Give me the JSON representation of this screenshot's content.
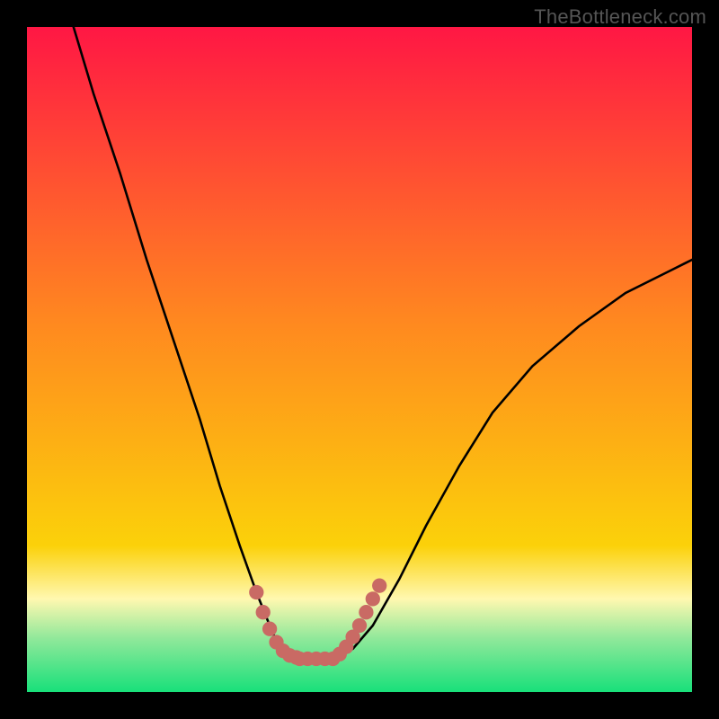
{
  "watermark": "TheBottleneck.com",
  "colors": {
    "frame": "#000000",
    "curve": "#000000",
    "dots": "#c96a64",
    "grad_top": "#ff1744",
    "grad_mid": "#fbd10a",
    "grad_low1": "#fff8b0",
    "grad_low2": "#8fe89a",
    "grad_bottom": "#18e07a"
  },
  "chart_data": {
    "type": "line",
    "title": "",
    "xlabel": "",
    "ylabel": "",
    "xlim": [
      0,
      100
    ],
    "ylim": [
      0,
      100
    ],
    "note": "x = normalized horizontal position (0 left → 100 right), y = normalized height (0 bottom → 100 top); values estimated from pixels",
    "series": [
      {
        "name": "curve",
        "x": [
          7,
          10,
          14,
          18,
          22,
          26,
          29,
          32,
          34.5,
          36.5,
          38,
          39.5,
          41,
          43,
          46,
          49,
          52,
          56,
          60,
          65,
          70,
          76,
          83,
          90,
          97,
          100
        ],
        "y": [
          100,
          90,
          78,
          65,
          53,
          41,
          31,
          22,
          15,
          10,
          6.5,
          5.2,
          5,
          5,
          5.2,
          6.5,
          10,
          17,
          25,
          34,
          42,
          49,
          55,
          60,
          63.5,
          65
        ]
      },
      {
        "name": "dots-left",
        "x": [
          34.5,
          35.5,
          36.5,
          37.5,
          38.5,
          39.5,
          40.5
        ],
        "y": [
          15,
          12,
          9.5,
          7.5,
          6.2,
          5.5,
          5.2
        ]
      },
      {
        "name": "dots-bottom",
        "x": [
          41,
          42.2,
          43.5,
          44.8,
          46
        ],
        "y": [
          5,
          5,
          5,
          5,
          5
        ]
      },
      {
        "name": "dots-right",
        "x": [
          47,
          48,
          49,
          50,
          51,
          52,
          53
        ],
        "y": [
          5.7,
          6.8,
          8.3,
          10,
          12,
          14,
          16
        ]
      }
    ]
  }
}
